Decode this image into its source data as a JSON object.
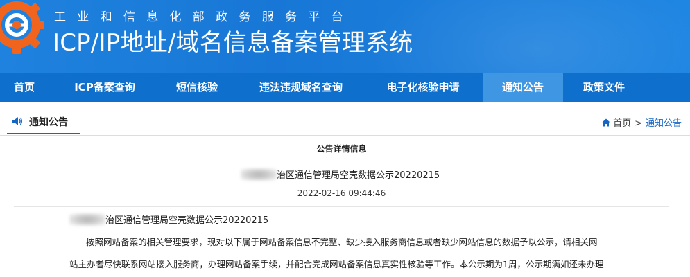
{
  "header": {
    "org_name": "工业和信息化部政务服务平台",
    "system_title": "ICP/IP地址/域名信息备案管理系统"
  },
  "nav": {
    "items": [
      {
        "label": "首页"
      },
      {
        "label": "ICP备案查询"
      },
      {
        "label": "短信核验"
      },
      {
        "label": "违法违规域名查询"
      },
      {
        "label": "电子化核验申请"
      },
      {
        "label": "通知公告",
        "active": true
      },
      {
        "label": "政策文件"
      }
    ]
  },
  "section": {
    "title": "通知公告",
    "icon": "speaker-icon"
  },
  "breadcrumb": {
    "home": "首页",
    "separator": ">",
    "current": "通知公告"
  },
  "notice": {
    "heading": "公告详情信息",
    "title": "治区通信管理局空壳数据公示20220215",
    "date": "2022-02-16 09:44:46",
    "body_title": "治区通信管理局空壳数据公示20220215",
    "paragraph_line1": "按照网站备案的相关管理要求，现对以下属于网站备案信息不完整、缺少接入服务商信息或者缺少网站信息的数据予以公示，请相关网",
    "paragraph_line2": "站主办者尽快联系网站接入服务商，办理网站备案手续，并配合完成网站备案信息真实性核验等工作。本公示期为1周，公示期满如还未办理"
  },
  "colors": {
    "header_blue": "#1f82de",
    "nav_blue": "#0e6fcd",
    "nav_active": "#3f96e3",
    "link_blue": "#1567c6",
    "logo_orange": "#f0641e"
  }
}
